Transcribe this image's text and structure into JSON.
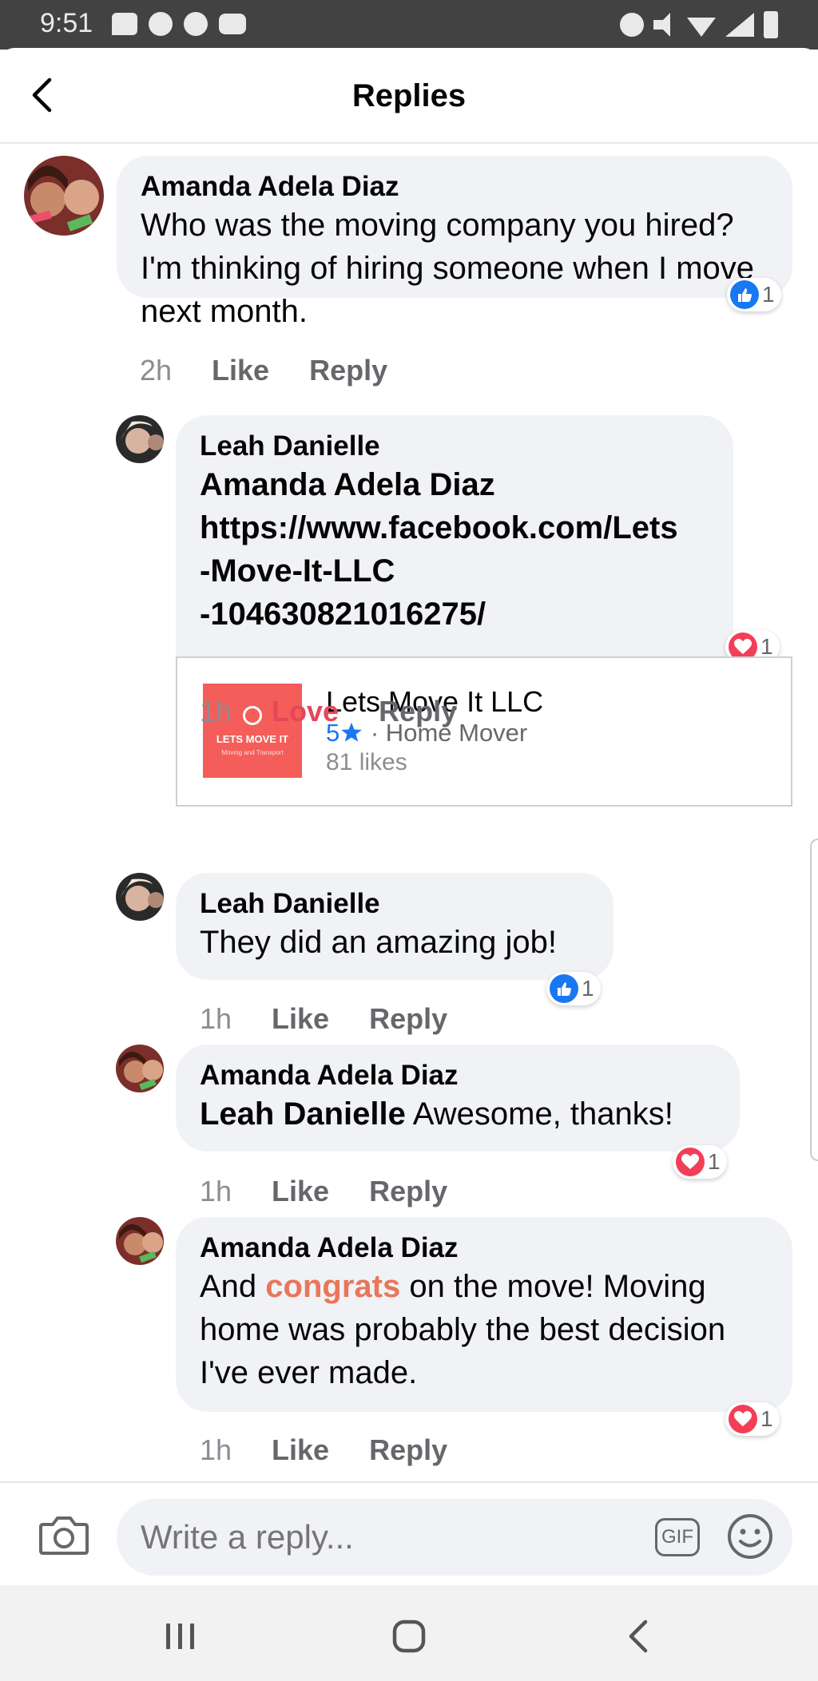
{
  "status_bar": {
    "time": "9:51"
  },
  "header": {
    "title": "Replies"
  },
  "comments": [
    {
      "author": "Amanda Adela Diaz",
      "text": "Who was the moving company you hired? I'm thinking of hiring someone when I move next month.",
      "time": "2h",
      "action1": "Like",
      "action2": "Reply",
      "reaction": "like",
      "reaction_count": "1"
    },
    {
      "author": "Leah Danielle",
      "mention": "Amanda Adela Diaz",
      "link_line1": "https://www.facebook.com/Lets",
      "link_line2": "-Move-It-LLC",
      "link_line3": "-104630821016275/",
      "time": "1h",
      "action1": "Love",
      "action2": "Reply",
      "reaction": "love",
      "reaction_count": "1"
    },
    {
      "author": "Leah Danielle",
      "text": "They did an amazing job!",
      "time": "1h",
      "action1": "Like",
      "action2": "Reply",
      "reaction": "like",
      "reaction_count": "1"
    },
    {
      "author": "Amanda Adela Diaz",
      "mention": "Leah Danielle",
      "text": "Awesome, thanks!",
      "time": "1h",
      "action1": "Like",
      "action2": "Reply",
      "reaction": "love",
      "reaction_count": "1"
    },
    {
      "author": "Amanda Adela Diaz",
      "text_before": "And",
      "highlight": "congrats",
      "text_after": "on the move! Moving home was probably the best decision I've ever made.",
      "time": "1h",
      "action1": "Like",
      "action2": "Reply",
      "reaction": "love",
      "reaction_count": "1"
    }
  ],
  "link_preview": {
    "thumb_title": "LETS MOVE IT",
    "thumb_subtitle": "Moving and Transport",
    "name": "Lets Move It LLC",
    "rating": "5",
    "category": "· Home Mover",
    "likes": "81 likes"
  },
  "composer": {
    "placeholder": "Write a reply...",
    "gif_label": "GIF"
  },
  "colors": {
    "like_blue": "#1877f2",
    "love_red": "#f33e58",
    "bubble_bg": "#f0f2f5",
    "highlight_orange": "#e9765b"
  }
}
